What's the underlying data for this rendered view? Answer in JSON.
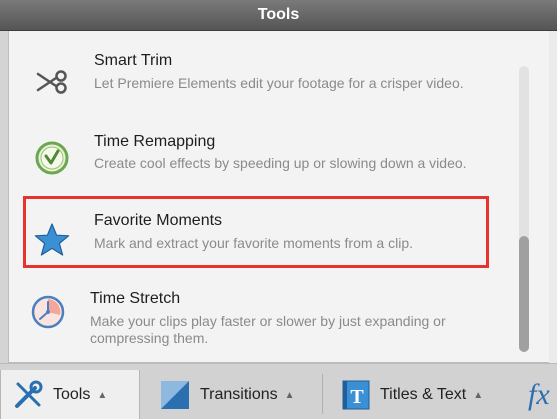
{
  "window": {
    "title": "Tools"
  },
  "tools": [
    {
      "name": "Smart Trim",
      "description": "Let Premiere Elements edit your footage for a crisper video.",
      "icon": "scissors-icon"
    },
    {
      "name": "Time Remapping",
      "description": "Create cool effects by speeding up or slowing down a video.",
      "icon": "clock-icon"
    },
    {
      "name": "Favorite Moments",
      "description": "Mark and extract your favorite moments from a clip.",
      "icon": "star-icon"
    },
    {
      "name": "Time Stretch",
      "description_line1": "Make your clips play faster or slower by just expanding or",
      "description_line2": "compressing them.",
      "icon": "stopwatch-icon"
    }
  ],
  "tabs": [
    {
      "label": "Tools",
      "caret": "▲",
      "icon": "tools-icon"
    },
    {
      "label": "Transitions",
      "caret": "▲",
      "icon": "transitions-icon"
    },
    {
      "label": "Titles & Text",
      "caret": "▲",
      "icon": "titles-text-icon"
    },
    {
      "label": "fx",
      "icon": "effects-icon"
    }
  ],
  "colors": {
    "highlight": "#e8322e",
    "accent_blue": "#3b8fd4",
    "accent_green": "#6aa84f"
  }
}
